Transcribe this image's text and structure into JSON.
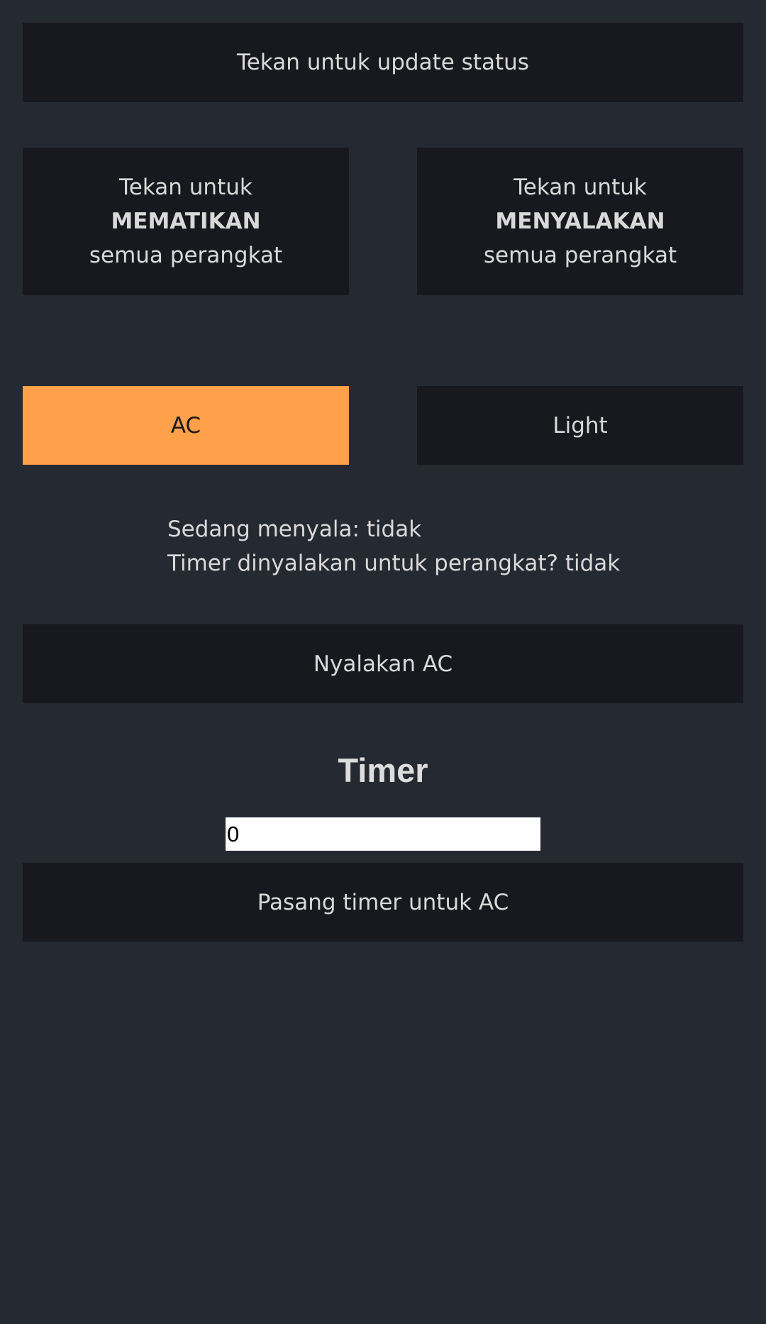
{
  "buttons": {
    "update_status": "Tekan untuk update status",
    "off_all": {
      "line1": "Tekan untuk",
      "line2": "MEMATIKAN",
      "line3": "semua perangkat"
    },
    "on_all": {
      "line1": "Tekan untuk",
      "line2": "MENYALAKAN",
      "line3": "semua perangkat"
    },
    "toggle_device": "Nyalakan AC",
    "set_timer": "Pasang timer untuk AC"
  },
  "tabs": [
    {
      "label": "AC",
      "active": true
    },
    {
      "label": "Light",
      "active": false
    }
  ],
  "status": {
    "on_line": "Sedang menyala: tidak",
    "timer_line": "Timer dinyalakan untuk perangkat? tidak"
  },
  "timer": {
    "title": "Timer",
    "value": "0"
  },
  "colors": {
    "background": "#252932",
    "button": "#18191e",
    "active_tab": "#ffa04a"
  }
}
